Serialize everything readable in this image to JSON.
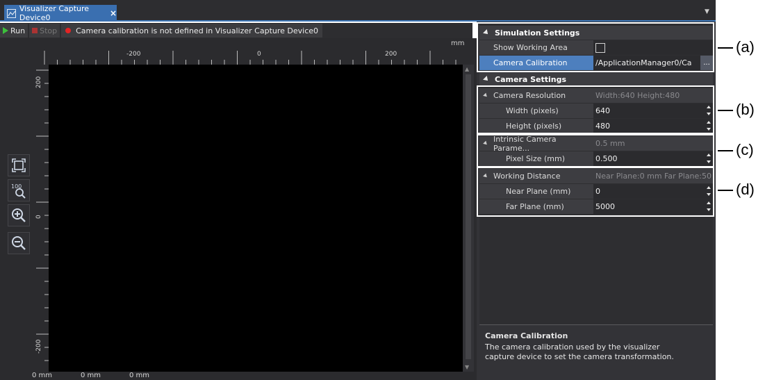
{
  "tab": {
    "title": "Visualizer Capture Device0",
    "close": "×"
  },
  "toolbar": {
    "run_label": "Run",
    "stop_label": "Stop",
    "message": "Camera calibration is not defined in Visualizer Capture Device0"
  },
  "ruler": {
    "unit": "mm",
    "h_ticks": [
      "-200",
      "0",
      "200"
    ],
    "v_ticks": [
      "200",
      "0",
      "-200"
    ],
    "bottom": [
      "0 mm",
      "0 mm",
      "0 mm"
    ]
  },
  "viewport_icons": [
    "fit-to-window-icon",
    "zoom-100-icon",
    "zoom-in-icon",
    "zoom-out-icon"
  ],
  "properties": {
    "simulation": {
      "title": "Simulation Settings",
      "show_working_area_label": "Show Working Area",
      "show_working_area_checked": false,
      "camera_calibration_label": "Camera Calibration",
      "camera_calibration_value": "/ApplicationManager0/Ca",
      "browse_label": "..."
    },
    "camera": {
      "title": "Camera Settings",
      "resolution_label": "Camera Resolution",
      "resolution_value": "Width:640 Height:480",
      "width_label": "Width (pixels)",
      "width_value": "640",
      "height_label": "Height (pixels)",
      "height_value": "480",
      "intrinsic_label": "Intrinsic Camera Parame...",
      "intrinsic_value": "0.5 mm",
      "pixel_size_label": "Pixel Size (mm)",
      "pixel_size_value": "0.500",
      "working_distance_label": "Working Distance",
      "working_distance_value": "Near Plane:0 mm Far Plane:50",
      "near_plane_label": "Near Plane (mm)",
      "near_plane_value": "0",
      "far_plane_label": "Far Plane (mm)",
      "far_plane_value": "5000"
    }
  },
  "description": {
    "title": "Camera Calibration",
    "body": "The camera calibration used by the visualizer capture device to set the camera transformation."
  },
  "annotations": [
    "(a)",
    "(b)",
    "(c)",
    "(d)"
  ],
  "colors": {
    "accent": "#3a6fb0",
    "selected_row": "#4d7fbe",
    "error_dot": "#e32424",
    "run_green": "#3cbf3c"
  }
}
